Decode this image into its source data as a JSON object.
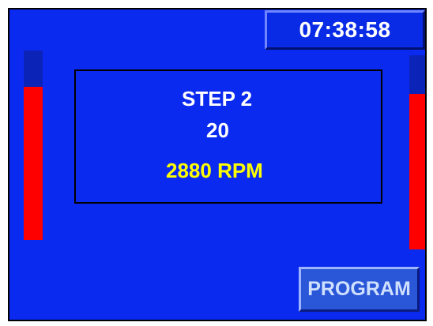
{
  "header": {
    "clock_time": "07:38:58"
  },
  "panel": {
    "step_label": "STEP 2",
    "value": "20",
    "speed": "2880 RPM"
  },
  "gauges": {
    "left_level_fraction": 0.81,
    "right_level_fraction": 0.8
  },
  "buttons": {
    "program_label": "PROGRAM"
  },
  "colors": {
    "background": "#0b2af0",
    "gauge_fill": "#ff0000",
    "gauge_track": "#0c23b8",
    "speed_text": "#ffff00",
    "label_text": "#ffffff"
  }
}
